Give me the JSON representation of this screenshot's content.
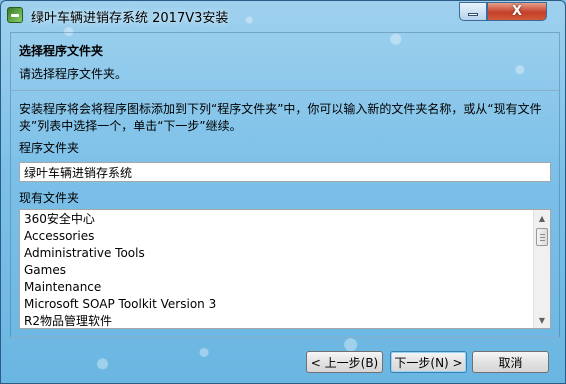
{
  "window": {
    "title": "绿叶车辆进销存系统 2017V3安装",
    "close_symbol": "X",
    "colors": {
      "close": "#c4402a",
      "background": "#7cc0e8"
    }
  },
  "header": {
    "title": "选择程序文件夹",
    "subtitle": "请选择程序文件夹。"
  },
  "main": {
    "description": "安装程序将会将程序图标添加到下列“程序文件夹”中，你可以输入新的文件夹名称，或从“现有文件夹”列表中选择一个，单击“下一步”继续。",
    "program_folder_label": "程序文件夹",
    "program_folder_value": "绿叶车辆进销存系统",
    "existing_folders_label": "现有文件夹",
    "existing_folders": [
      "360安全中心",
      "Accessories",
      "Administrative Tools",
      "Games",
      "Maintenance",
      "Microsoft SOAP Toolkit Version 3",
      "R2物品管理软件"
    ]
  },
  "footer": {
    "back_label": "< 上一步(B)",
    "next_label": "下一步(N) >",
    "cancel_label": "取消"
  }
}
